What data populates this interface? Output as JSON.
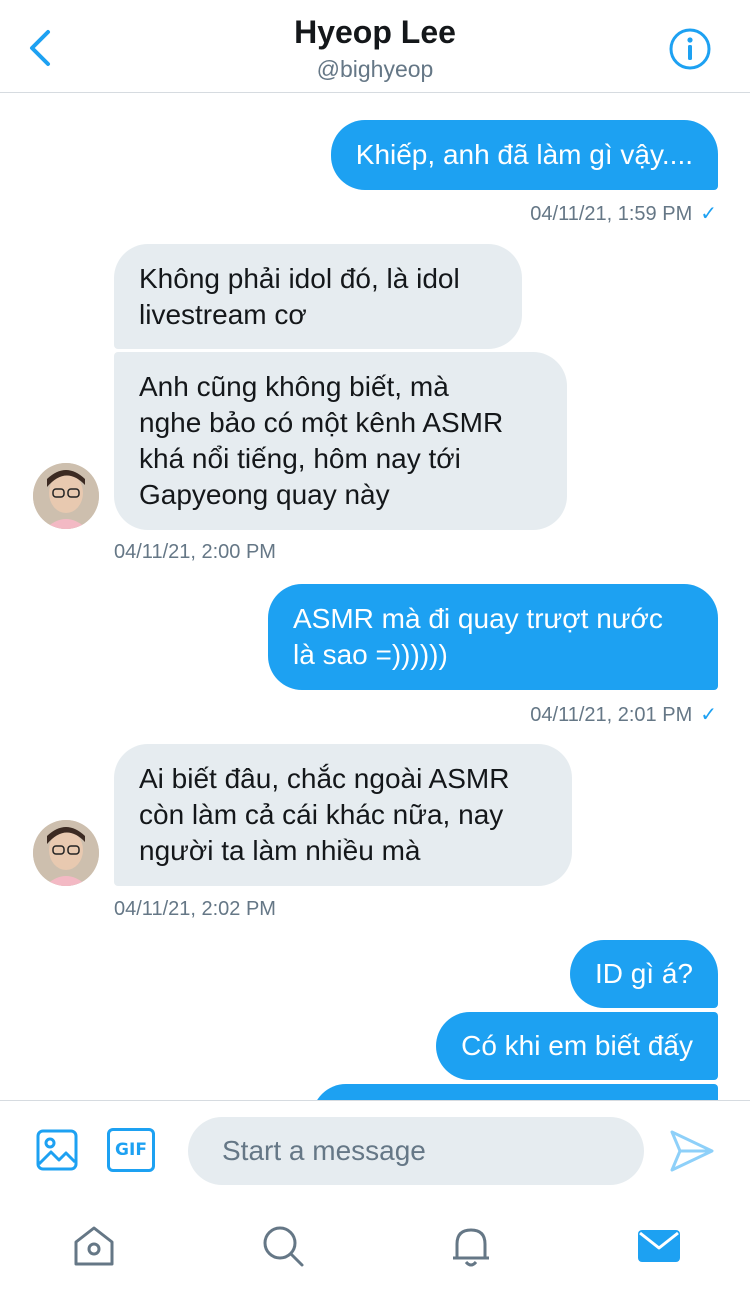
{
  "header": {
    "title": "Hyeop Lee",
    "handle": "@bighyeop"
  },
  "messages": [
    {
      "from": "me",
      "text": "Khiếp, anh đã làm gì vậy...."
    },
    {
      "timestamp": "04/11/21, 1:59 PM"
    },
    {
      "from": "them",
      "text": "Không phải idol đó, là idol livestream cơ"
    },
    {
      "from": "them",
      "text": "Anh cũng không biết, mà nghe bảo có một kênh ASMR khá nổi tiếng, hôm nay tới Gapyeong quay này"
    },
    {
      "timestamp": "04/11/21, 2:00 PM"
    },
    {
      "from": "me",
      "text": "ASMR mà đi quay trượt nước là sao =))))))"
    },
    {
      "timestamp": "04/11/21, 2:01 PM"
    },
    {
      "from": "them",
      "text": "Ai biết đâu, chắc ngoài ASMR còn làm cả cái khác nữa, nay người ta làm nhiều mà"
    },
    {
      "timestamp": "04/11/21, 2:02 PM"
    },
    {
      "from": "me",
      "text": "ID gì á?"
    },
    {
      "from": "me",
      "text": "Có khi em biết đấy"
    }
  ],
  "m": {
    "msg1": "Khiếp, anh đã làm gì vậy....",
    "ts1": "04/11/21, 1:59 PM",
    "msg2_line1": "Không phải idol đó, là idol",
    "msg2_line2": "livestream cơ",
    "msg3_line1": "Anh cũng không biết, mà",
    "msg3_line2": "nghe bảo có một kênh ASMR",
    "msg3_line3": "khá nổi tiếng, hôm nay tới",
    "msg3_line4": "Gapyeong quay này",
    "ts2": "04/11/21, 2:00 PM",
    "msg4_line1": "ASMR mà đi quay trượt nước",
    "msg4_line2": "là sao =))))))",
    "ts3": "04/11/21, 2:01 PM",
    "msg5_line1": "Ai biết đâu, chắc ngoài ASMR",
    "msg5_line2": "còn làm cả cái khác nữa, nay",
    "msg5_line3": "người ta làm nhiều mà",
    "ts4": "04/11/21, 2:02 PM",
    "msg6": "ID gì á?",
    "msg7": "Có khi em biết đấy"
  },
  "composer": {
    "gif_label": "GIF",
    "placeholder": "Start a message"
  },
  "icons": {
    "back": "chevron-left-icon",
    "info": "info-icon",
    "media": "image-icon",
    "send": "send-icon",
    "tabs": [
      "home-icon",
      "search-icon",
      "bell-icon",
      "mail-icon"
    ]
  },
  "colors": {
    "accent": "#1da1f2",
    "bubble_received": "#e6ecf0",
    "muted_text": "#657786"
  }
}
